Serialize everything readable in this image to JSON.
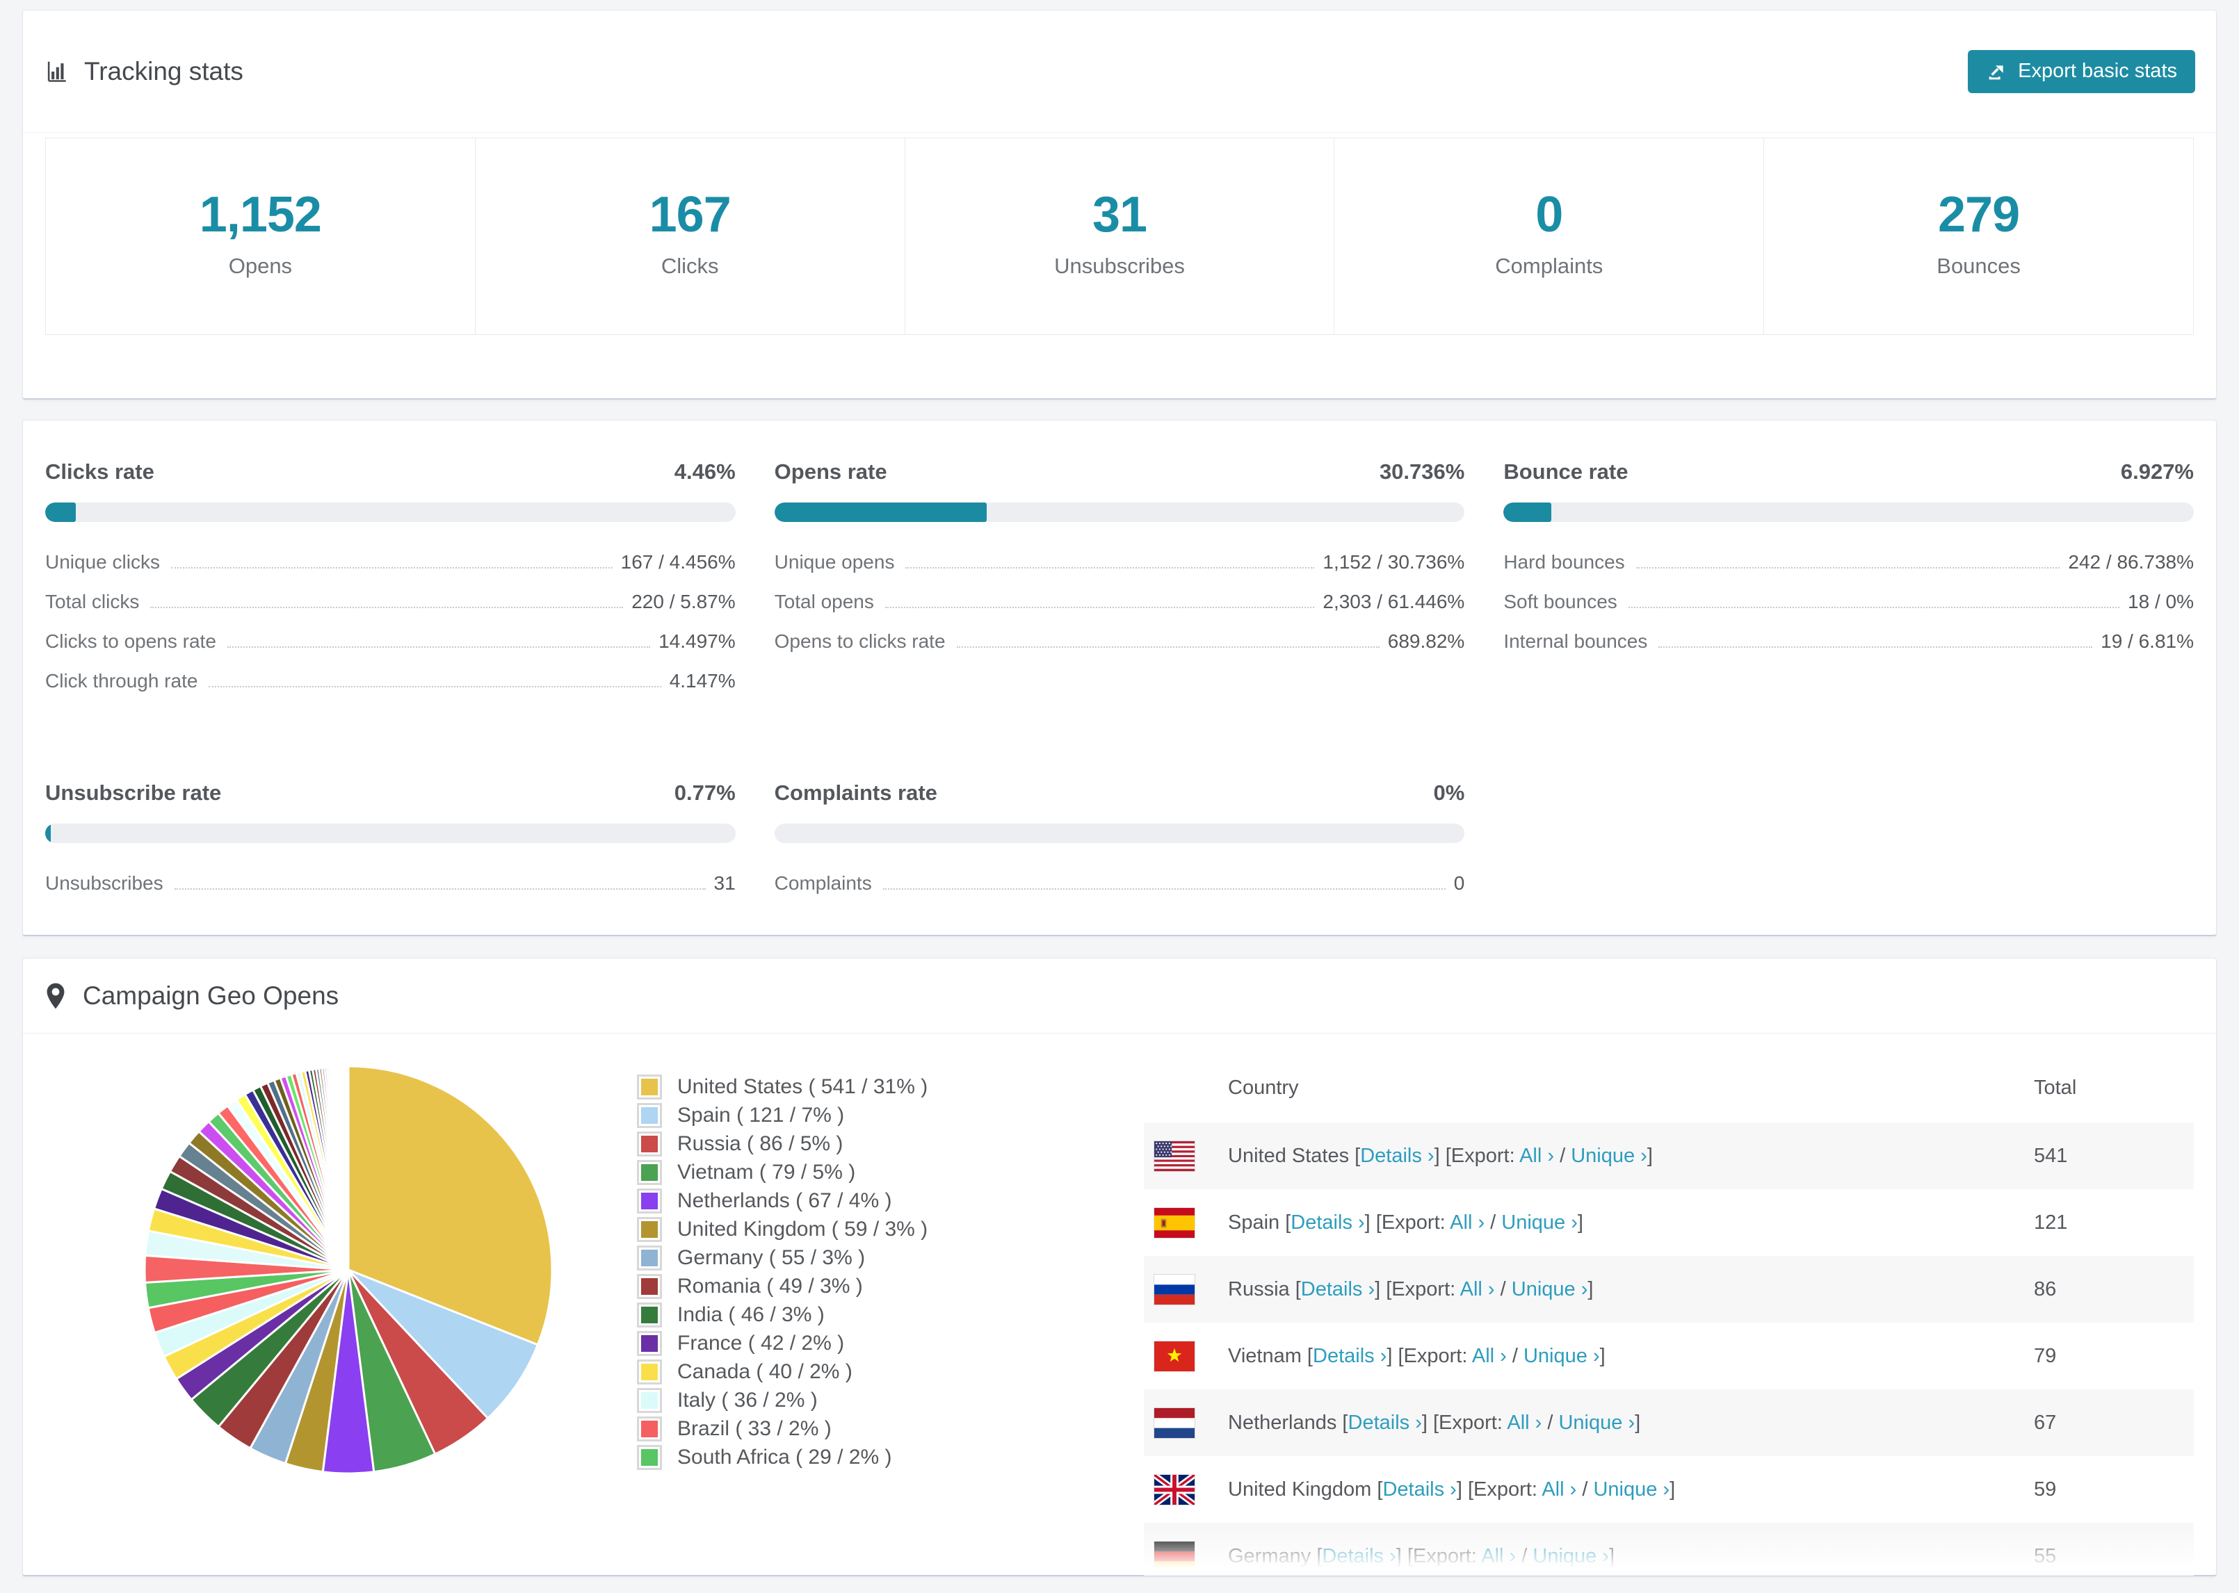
{
  "page": {
    "background": "#f4f5f7",
    "accent": "#1d8ca3",
    "link_color": "#2d9dbd"
  },
  "tracking": {
    "title": "Tracking stats",
    "export_button": "Export basic stats",
    "stats": [
      {
        "value": "1,152",
        "label": "Opens"
      },
      {
        "value": "167",
        "label": "Clicks"
      },
      {
        "value": "31",
        "label": "Unsubscribes"
      },
      {
        "value": "0",
        "label": "Complaints"
      },
      {
        "value": "279",
        "label": "Bounces"
      }
    ]
  },
  "rates": [
    {
      "title": "Clicks rate",
      "value": "4.46%",
      "percent": 4.46,
      "rows": [
        {
          "label": "Unique clicks",
          "value": "167 / 4.456%"
        },
        {
          "label": "Total clicks",
          "value": "220 / 5.87%"
        },
        {
          "label": "Clicks to opens rate",
          "value": "14.497%"
        },
        {
          "label": "Click through rate",
          "value": "4.147%"
        }
      ]
    },
    {
      "title": "Opens rate",
      "value": "30.736%",
      "percent": 30.736,
      "rows": [
        {
          "label": "Unique opens",
          "value": "1,152 / 30.736%"
        },
        {
          "label": "Total opens",
          "value": "2,303 / 61.446%"
        },
        {
          "label": "Opens to clicks rate",
          "value": "689.82%"
        }
      ]
    },
    {
      "title": "Bounce rate",
      "value": "6.927%",
      "percent": 6.927,
      "rows": [
        {
          "label": "Hard bounces",
          "value": "242 / 86.738%"
        },
        {
          "label": "Soft bounces",
          "value": "18 / 0%"
        },
        {
          "label": "Internal bounces",
          "value": "19 / 6.81%"
        }
      ]
    },
    {
      "title": "Unsubscribe rate",
      "value": "0.77%",
      "percent": 0.77,
      "rows": [
        {
          "label": "Unsubscribes",
          "value": "31"
        }
      ]
    },
    {
      "title": "Complaints rate",
      "value": "0%",
      "percent": 0,
      "rows": [
        {
          "label": "Complaints",
          "value": "0"
        }
      ]
    }
  ],
  "geo": {
    "title": "Campaign Geo Opens",
    "chart_data": {
      "type": "pie",
      "title": "Campaign Geo Opens",
      "legend_position": "right",
      "unit": "opens",
      "categories": [
        "United States",
        "Spain",
        "Russia",
        "Vietnam",
        "Netherlands",
        "United Kingdom",
        "Germany",
        "Romania",
        "India",
        "France",
        "Canada",
        "Italy",
        "Brazil",
        "South Africa"
      ],
      "values": [
        541,
        121,
        86,
        79,
        67,
        59,
        55,
        49,
        46,
        42,
        40,
        36,
        33,
        29
      ],
      "percents": [
        31,
        7,
        5,
        5,
        4,
        3,
        3,
        3,
        3,
        2,
        2,
        2,
        2,
        2
      ],
      "others_percent": 26,
      "colors": [
        "#e7c34c",
        "#aed5f2",
        "#cb4a4a",
        "#4ba250",
        "#8a3ff0",
        "#b2952f",
        "#8fb3d2",
        "#a03b3b",
        "#357c3c",
        "#6a2fa5",
        "#f9e04b",
        "#dafbfa",
        "#f55f60",
        "#57c663"
      ],
      "tail_colors": [
        "#f56364",
        "#e0fbfa",
        "#fae14b",
        "#4f2490",
        "#2f6f36",
        "#8e3a3a",
        "#66818f",
        "#8e7a26",
        "#cb4ff0",
        "#5dca6b",
        "#ff6666",
        "#eeffff",
        "#ffff55",
        "#3b2f96",
        "#1f5e2d",
        "#7c2929",
        "#50708a",
        "#6f5f1f",
        "#d44ef0",
        "#66e666"
      ]
    },
    "legend": [
      {
        "color": "#e7c34c",
        "label": "United States ( 541 / 31% )"
      },
      {
        "color": "#aed5f2",
        "label": "Spain ( 121 / 7% )"
      },
      {
        "color": "#cb4a4a",
        "label": "Russia ( 86 / 5% )"
      },
      {
        "color": "#4ba250",
        "label": "Vietnam ( 79 / 5% )"
      },
      {
        "color": "#8a3ff0",
        "label": "Netherlands ( 67 / 4% )"
      },
      {
        "color": "#b2952f",
        "label": "United Kingdom ( 59 / 3% )"
      },
      {
        "color": "#8fb3d2",
        "label": "Germany ( 55 / 3% )"
      },
      {
        "color": "#a03b3b",
        "label": "Romania ( 49 / 3% )"
      },
      {
        "color": "#357c3c",
        "label": "India ( 46 / 3% )"
      },
      {
        "color": "#6a2fa5",
        "label": "France ( 42 / 2% )"
      },
      {
        "color": "#f9e04b",
        "label": "Canada ( 40 / 2% )"
      },
      {
        "color": "#dafbfa",
        "label": "Italy ( 36 / 2% )"
      },
      {
        "color": "#f55f60",
        "label": "Brazil ( 33 / 2% )"
      },
      {
        "color": "#57c663",
        "label": "South Africa ( 29 / 2% )"
      }
    ],
    "table": {
      "col_country": "Country",
      "col_total": "Total",
      "details_label": "Details ›",
      "bracket_open": " [",
      "bracket_close": "]",
      "export_prefix": "] [Export: ",
      "all_label": "All ›",
      "slash": " / ",
      "unique_label": "Unique ›",
      "rows": [
        {
          "country": "United States",
          "flag": "us",
          "total": "541"
        },
        {
          "country": "Spain",
          "flag": "es",
          "total": "121"
        },
        {
          "country": "Russia",
          "flag": "ru",
          "total": "86"
        },
        {
          "country": "Vietnam",
          "flag": "vn",
          "total": "79"
        },
        {
          "country": "Netherlands",
          "flag": "nl",
          "total": "67"
        },
        {
          "country": "United Kingdom",
          "flag": "gb",
          "total": "59"
        },
        {
          "country": "Germany",
          "flag": "de",
          "total": "55"
        }
      ]
    }
  }
}
